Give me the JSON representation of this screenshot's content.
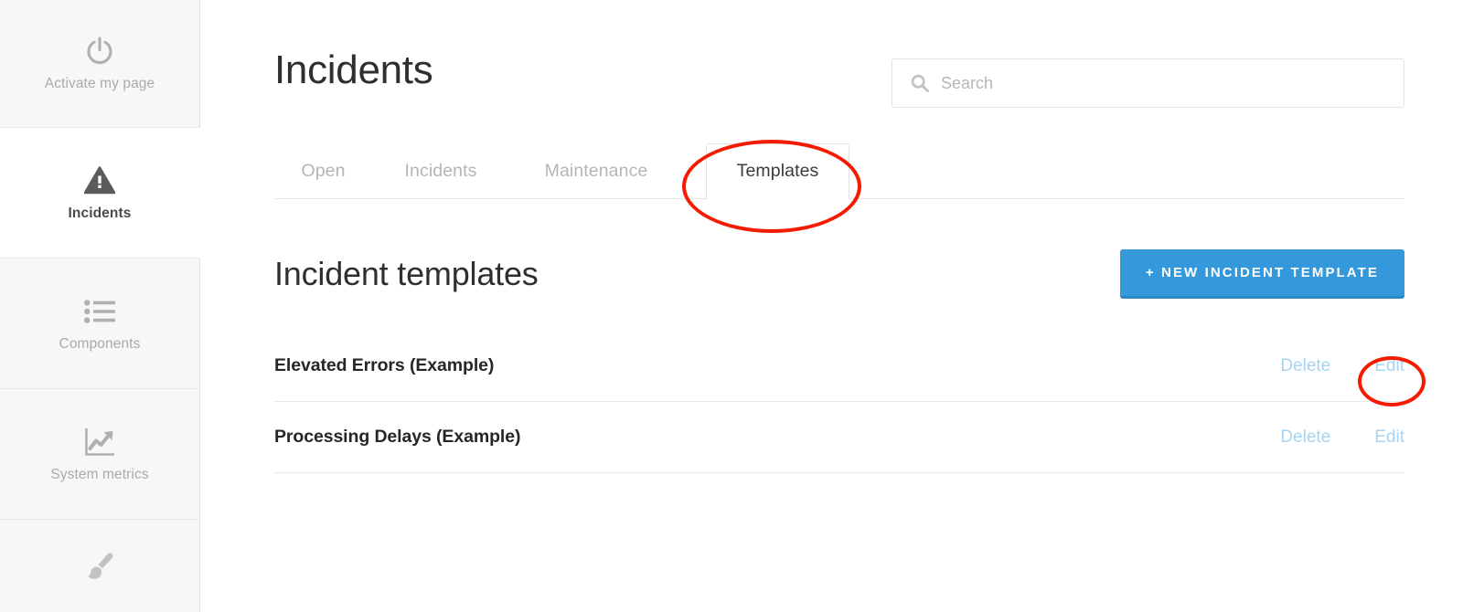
{
  "sidebar": {
    "items": [
      {
        "label": "Activate my page",
        "icon": "power-icon",
        "active": false
      },
      {
        "label": "Incidents",
        "icon": "warning-triangle-icon",
        "active": true
      },
      {
        "label": "Components",
        "icon": "list-icon",
        "active": false
      },
      {
        "label": "System metrics",
        "icon": "chart-line-icon",
        "active": false
      },
      {
        "label": "",
        "icon": "paintbrush-icon",
        "active": false
      }
    ]
  },
  "header": {
    "title": "Incidents",
    "search": {
      "placeholder": "Search",
      "value": "",
      "icon": "search-icon"
    }
  },
  "tabs": [
    {
      "label": "Open",
      "active": false
    },
    {
      "label": "Incidents",
      "active": false
    },
    {
      "label": "Maintenance",
      "active": false
    },
    {
      "label": "Templates",
      "active": true
    }
  ],
  "section": {
    "title": "Incident templates",
    "new_button_label": "+ NEW INCIDENT TEMPLATE"
  },
  "templates": {
    "actions": {
      "delete_label": "Delete",
      "edit_label": "Edit"
    },
    "rows": [
      {
        "name": "Elevated Errors (Example)"
      },
      {
        "name": "Processing Delays (Example)"
      }
    ]
  },
  "annotations": [
    {
      "name": "templates-tab-highlight",
      "shape": "ellipse",
      "color": "#f41b00"
    },
    {
      "name": "edit-link-highlight",
      "shape": "ellipse",
      "color": "#f41b00"
    }
  ],
  "colors": {
    "accent_blue": "#3498db",
    "link_blue": "#a8d4f2",
    "annotation_red": "#f41b00",
    "sidebar_bg": "#f7f7f7",
    "text_dark": "#2f2f2f",
    "text_muted": "#aaaaaa"
  }
}
